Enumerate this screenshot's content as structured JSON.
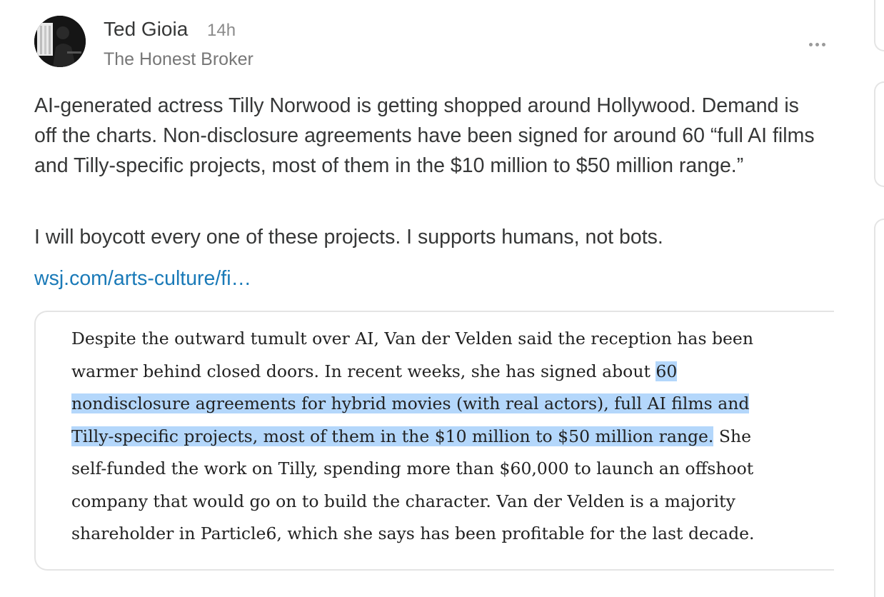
{
  "post": {
    "author": {
      "name": "Ted Gioia",
      "publication": "The Honest Broker",
      "avatar_icon": "author-photo"
    },
    "timestamp": "14h",
    "more_icon": "ellipsis-icon",
    "paragraphs": [
      "AI-generated actress Tilly Norwood is getting shopped around Hollywood. Demand is off the charts. Non-disclosure agreements have been signed for around 60 “full AI films and Tilly-specific projects, most of them in the $10 million to $50 million range.”",
      "I will boycott every one of these projects. I supports humans, not bots."
    ],
    "link_text": "wsj.com/arts-culture/fi…"
  },
  "quote": {
    "before_highlight": "Despite the outward tumult over AI, Van der Velden said the reception has been warmer behind closed doors. In recent weeks, she has signed about ",
    "highlight": "60 nondisclosure agreements for hybrid movies (with real actors), full AI films and Tilly-specific projects, most of them in the $10 million to $50 million range.",
    "after_highlight": " She self-funded the work on Tilly, spending more than $60,000 to launch an offshoot company that would go on to build the character. Van der Velden is a majority shareholder in Particle6, which she says has been profitable for the last decade.",
    "highlight_color": "#b4d7fb"
  },
  "colors": {
    "text": "#363737",
    "muted": "#777777",
    "link": "#1a7ab8",
    "border": "#e4e4e4"
  }
}
